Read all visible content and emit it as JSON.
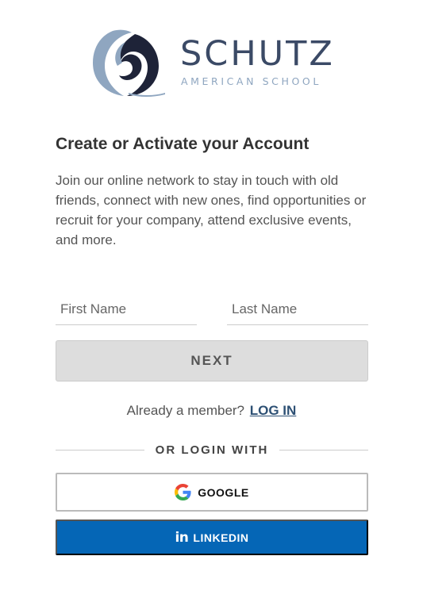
{
  "brand": {
    "name": "SCHUTZ",
    "subtitle": "AMERICAN SCHOOL",
    "colors": {
      "navy": "#3b4a66",
      "light_blue": "#8fa6c0",
      "dark": "#1e2338"
    }
  },
  "form": {
    "title": "Create or Activate your Account",
    "description": "Join our online network to stay in touch with old friends, connect with new ones, find opportunities or recruit for your company, attend exclusive events, and more.",
    "first_name_placeholder": "First Name",
    "last_name_placeholder": "Last Name",
    "next_label": "NEXT"
  },
  "login": {
    "prompt": "Already a member?",
    "link": "LOG IN",
    "divider": "OR LOGIN WITH"
  },
  "social": {
    "google": {
      "label": "GOOGLE",
      "icon": "google-icon"
    },
    "linkedin": {
      "label": "LINKEDIN",
      "icon": "linkedin-icon",
      "glyph": "in",
      "color": "#0566b6"
    }
  }
}
